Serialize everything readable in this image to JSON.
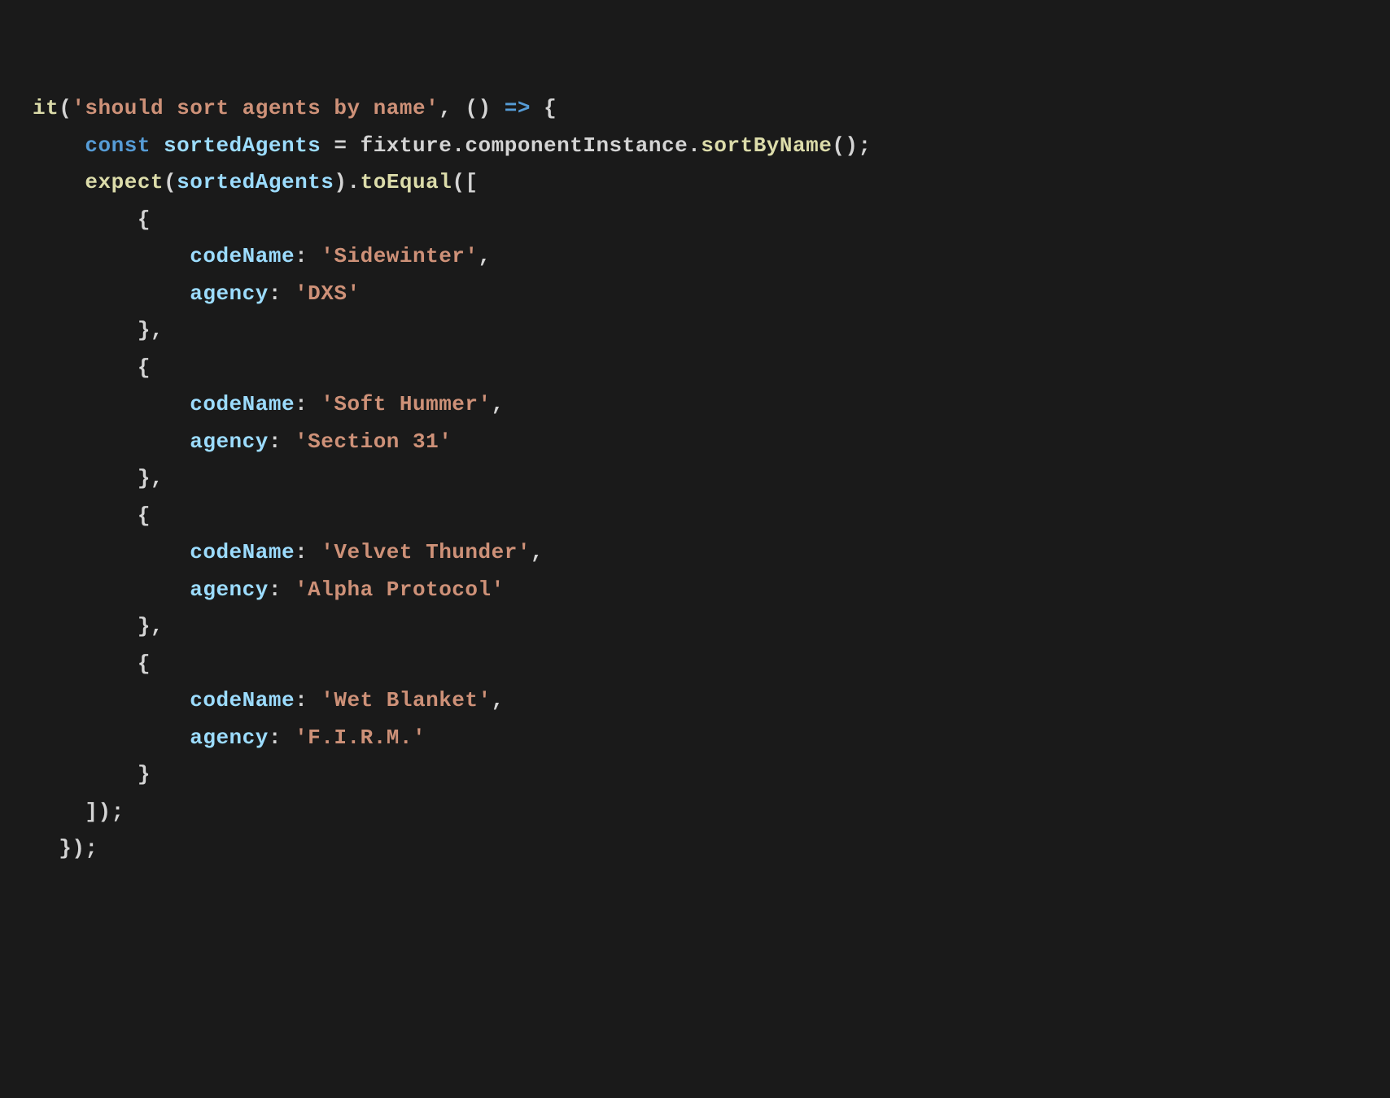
{
  "line1": {
    "fn": "it",
    "p1": "(",
    "str": "'should sort agents by name'",
    "comma": ", ",
    "paren2": "()",
    "arrow": " => ",
    "brace": "{"
  },
  "line2": {
    "indent": "    ",
    "kw": "const",
    "sp1": " ",
    "var": "sortedAgents",
    "eq": " = ",
    "obj1": "fixture",
    "dot1": ".",
    "obj2": "componentInstance",
    "dot2": ".",
    "fn": "sortByName",
    "paren": "()",
    "semi": ";"
  },
  "line3": {
    "indent": "    ",
    "fn1": "expect",
    "p1": "(",
    "var": "sortedAgents",
    "p2": ")",
    "dot": ".",
    "fn2": "toEqual",
    "p3": "(["
  },
  "line4": {
    "indent": "        ",
    "brace": "{"
  },
  "line5": {
    "indent": "            ",
    "prop": "codeName",
    "colon": ": ",
    "str": "'Sidewinter'",
    "comma": ","
  },
  "line6": {
    "indent": "            ",
    "prop": "agency",
    "colon": ": ",
    "str": "'DXS'"
  },
  "line7": {
    "indent": "        ",
    "text": "},"
  },
  "line8": {
    "indent": "        ",
    "brace": "{"
  },
  "line9": {
    "indent": "            ",
    "prop": "codeName",
    "colon": ": ",
    "str": "'Soft Hummer'",
    "comma": ","
  },
  "line10": {
    "indent": "            ",
    "prop": "agency",
    "colon": ": ",
    "str": "'Section 31'"
  },
  "line11": {
    "indent": "        ",
    "text": "},"
  },
  "line12": {
    "indent": "        ",
    "brace": "{"
  },
  "line13": {
    "indent": "            ",
    "prop": "codeName",
    "colon": ": ",
    "str": "'Velvet Thunder'",
    "comma": ","
  },
  "line14": {
    "indent": "            ",
    "prop": "agency",
    "colon": ": ",
    "str": "'Alpha Protocol'"
  },
  "line15": {
    "indent": "        ",
    "text": "},"
  },
  "line16": {
    "indent": "        ",
    "brace": "{"
  },
  "line17": {
    "indent": "            ",
    "prop": "codeName",
    "colon": ": ",
    "str": "'Wet Blanket'",
    "comma": ","
  },
  "line18": {
    "indent": "            ",
    "prop": "agency",
    "colon": ": ",
    "str": "'F.I.R.M.'"
  },
  "line19": {
    "indent": "        ",
    "brace": "}"
  },
  "line20": {
    "indent": "    ",
    "text": "]);"
  },
  "line21": {
    "indent": "  ",
    "text": "});"
  }
}
